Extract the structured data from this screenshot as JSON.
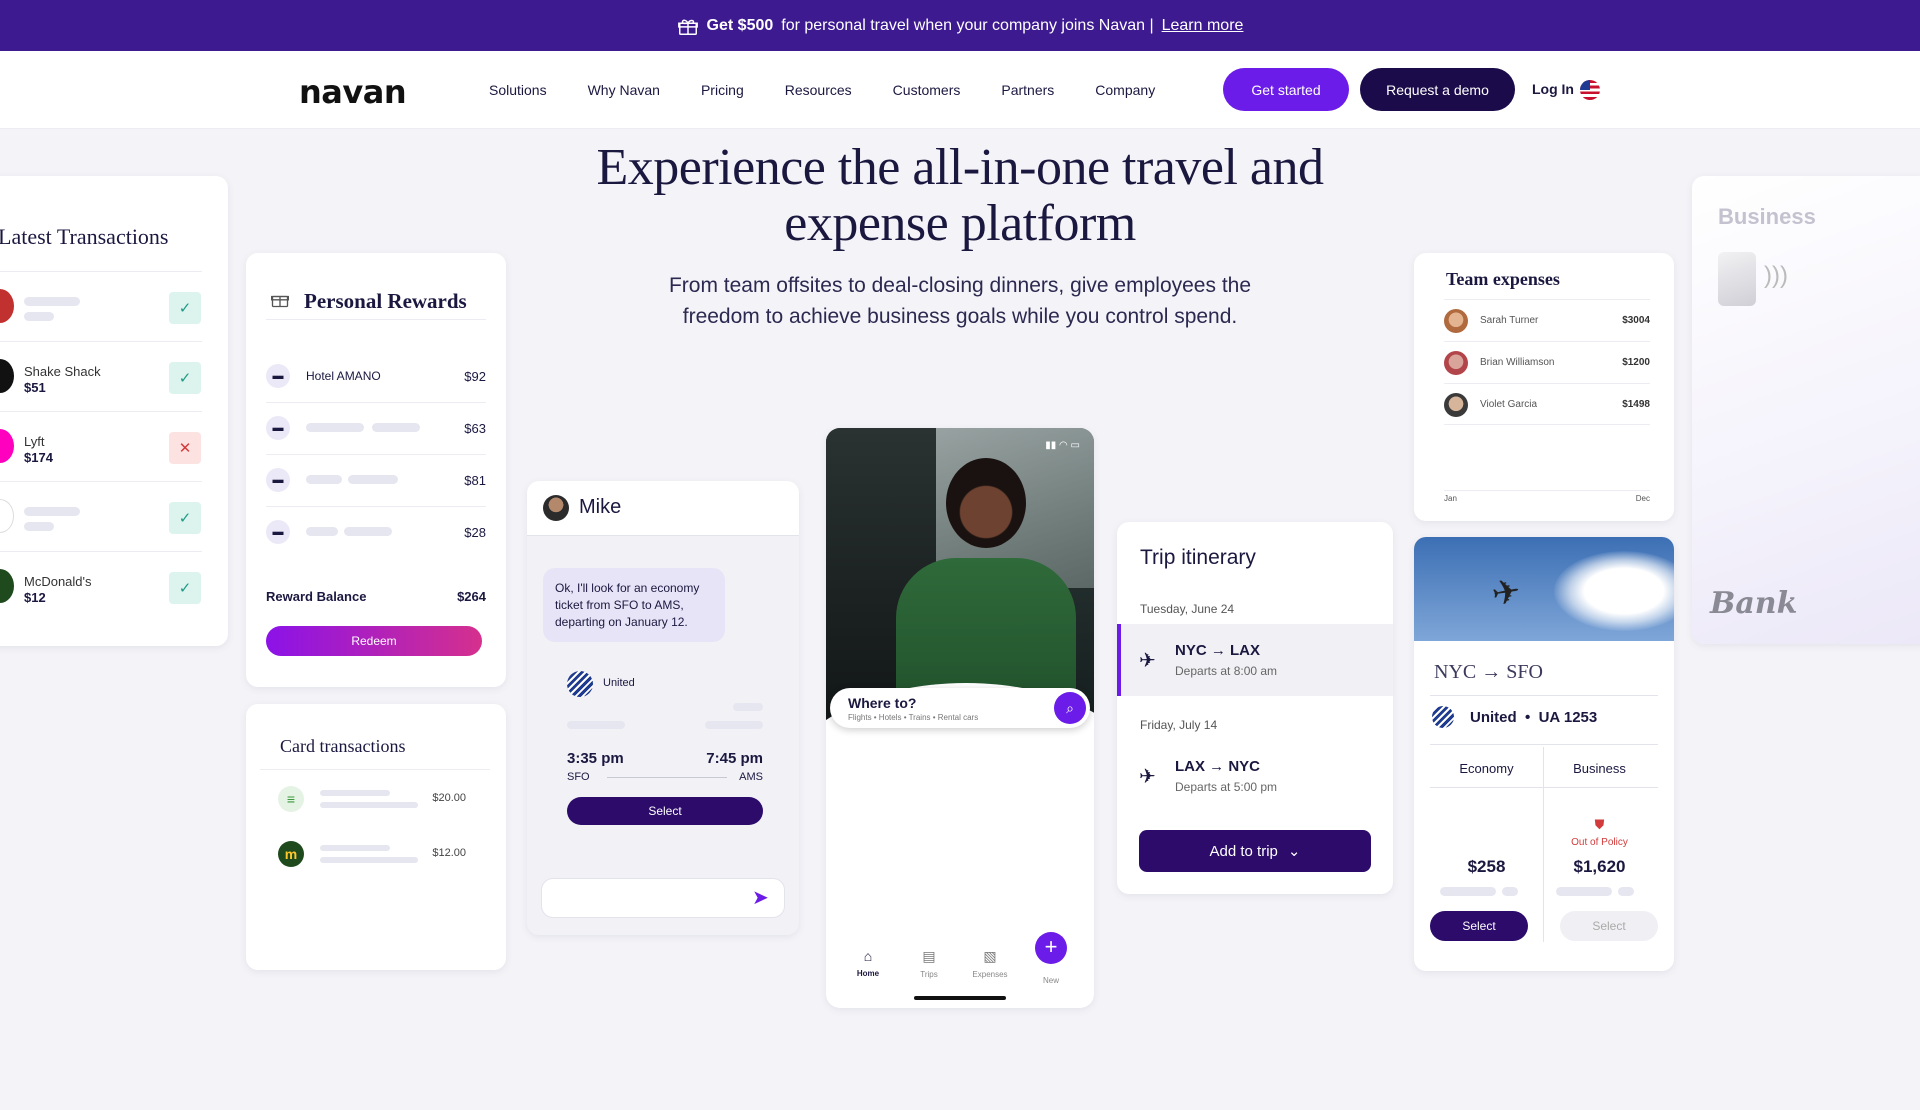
{
  "banner": {
    "bold": "Get $500",
    "text": "for personal travel when your company joins Navan |",
    "link": "Learn more"
  },
  "nav": {
    "logo": "navan",
    "links": [
      "Solutions",
      "Why Navan",
      "Pricing",
      "Resources",
      "Customers",
      "Partners",
      "Company"
    ],
    "get_started": "Get started",
    "request_demo": "Request a demo",
    "login": "Log In"
  },
  "hero": {
    "title_1": "Experience the all-in-one travel and",
    "title_2": "expense platform",
    "subtitle_1": "From team offsites to deal-closing dinners, give employees the",
    "subtitle_2": "freedom to achieve business goals while you control spend."
  },
  "latest_transactions": {
    "title": "Latest Transactions",
    "rows": [
      {
        "name": "",
        "amount": "",
        "status": "✓"
      },
      {
        "name": "Shake Shack",
        "amount": "$51",
        "status": "✓"
      },
      {
        "name": "Lyft",
        "amount": "$174",
        "status": "✕"
      },
      {
        "name": "",
        "amount": "",
        "status": "✓"
      },
      {
        "name": "McDonald's",
        "amount": "$12",
        "status": "✓"
      }
    ]
  },
  "personal_rewards": {
    "title": "Personal Rewards",
    "rows": [
      {
        "name": "Hotel AMANO",
        "amount": "$92"
      },
      {
        "name": "",
        "amount": "$63"
      },
      {
        "name": "",
        "amount": "$81"
      },
      {
        "name": "",
        "amount": "$28"
      }
    ],
    "balance_label": "Reward Balance",
    "balance_value": "$264",
    "redeem": "Redeem"
  },
  "card_transactions": {
    "title": "Card transactions",
    "rows": [
      {
        "amount": "$20.00"
      },
      {
        "amount": "$12.00"
      }
    ]
  },
  "chat": {
    "name": "Mike",
    "message": "Ok, I'll look for an economy ticket from SFO to AMS, departing on January 12.",
    "flight": {
      "airline": "United",
      "depart_time": "3:35 pm",
      "arrive_time": "7:45 pm",
      "from": "SFO",
      "to": "AMS",
      "select": "Select"
    }
  },
  "phone": {
    "where_title": "Where to?",
    "where_sub": "Flights • Hotels • Trains • Rental cars",
    "tabs": [
      "Home",
      "Trips",
      "Expenses",
      "New"
    ]
  },
  "trip_itinerary": {
    "title": "Trip itinerary",
    "segments": [
      {
        "date": "Tuesday, June 24",
        "route_from": "NYC",
        "route_to": "LAX",
        "depart": "Departs at 8:00 am"
      },
      {
        "date": "Friday, July 14",
        "route_from": "LAX",
        "route_to": "NYC",
        "depart": "Departs at 5:00 pm"
      }
    ],
    "add_button": "Add to trip"
  },
  "team_expenses": {
    "title": "Team expenses",
    "rows": [
      {
        "name": "Sarah Turner",
        "amount": "$3004"
      },
      {
        "name": "Brian Williamson",
        "amount": "$1200"
      },
      {
        "name": "Violet Garcia",
        "amount": "$1498"
      }
    ],
    "axis_start": "Jan",
    "axis_end": "Dec"
  },
  "flight_compare": {
    "route_from": "NYC",
    "route_to": "SFO",
    "airline": "United",
    "flight_no": "UA 1253",
    "classes": [
      {
        "name": "Economy",
        "price": "$258",
        "select": "Select"
      },
      {
        "name": "Business",
        "price": "$1,620",
        "select": "Select",
        "policy": "Out of Policy"
      }
    ]
  },
  "business_card": {
    "label": "Business",
    "bank": "Bank"
  },
  "colors": {
    "banner": "#3d1a8f",
    "accent": "#6b1ce8",
    "dark": "#1b0b4a"
  }
}
